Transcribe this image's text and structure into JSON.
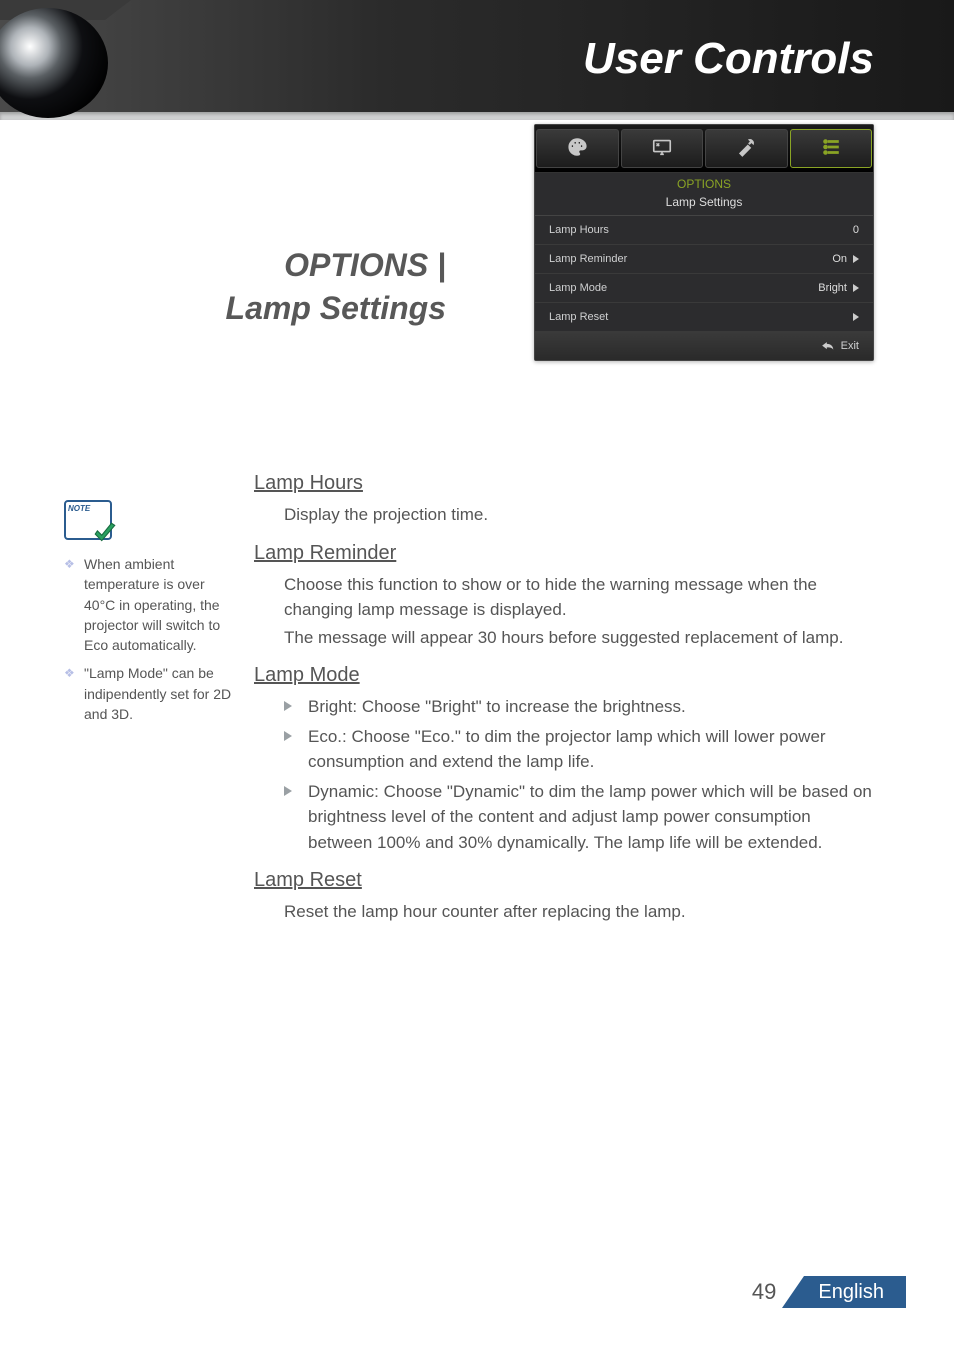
{
  "header": {
    "title": "User Controls"
  },
  "section": {
    "line1": "OPTIONS |",
    "line2": "Lamp Settings"
  },
  "osd": {
    "title": "OPTIONS",
    "subtitle": "Lamp Settings",
    "rows": [
      {
        "label": "Lamp Hours",
        "value": "0",
        "arrow": false
      },
      {
        "label": "Lamp Reminder",
        "value": "On",
        "arrow": true
      },
      {
        "label": "Lamp Mode",
        "value": "Bright",
        "arrow": true
      },
      {
        "label": "Lamp Reset",
        "value": "",
        "arrow": true
      }
    ],
    "exit": "Exit"
  },
  "notes": [
    "When ambient temperature is over 40°C in operating, the projector will switch to Eco automatically.",
    "\"Lamp Mode\" can be indipendently set for 2D and 3D."
  ],
  "content": {
    "lamp_hours": {
      "head": "Lamp Hours",
      "body": [
        "Display the projection time."
      ]
    },
    "lamp_reminder": {
      "head": "Lamp Reminder",
      "body": [
        "Choose this function to show or to hide the warning message when the changing lamp message is displayed.",
        "The message will appear 30 hours before suggested replacement of lamp."
      ]
    },
    "lamp_mode": {
      "head": "Lamp Mode",
      "items": [
        "Bright: Choose \"Bright\" to increase the brightness.",
        "Eco.: Choose \"Eco.\" to dim the projector lamp which will lower power consumption and extend the lamp life.",
        "Dynamic: Choose \"Dynamic\" to dim the lamp power which will be based on brightness level of the content and adjust lamp power consumption between 100% and 30% dynamically. The lamp life will be extended."
      ]
    },
    "lamp_reset": {
      "head": "Lamp Reset",
      "body": [
        "Reset the lamp hour counter after replacing the lamp."
      ]
    }
  },
  "footer": {
    "page": "49",
    "lang": "English"
  }
}
